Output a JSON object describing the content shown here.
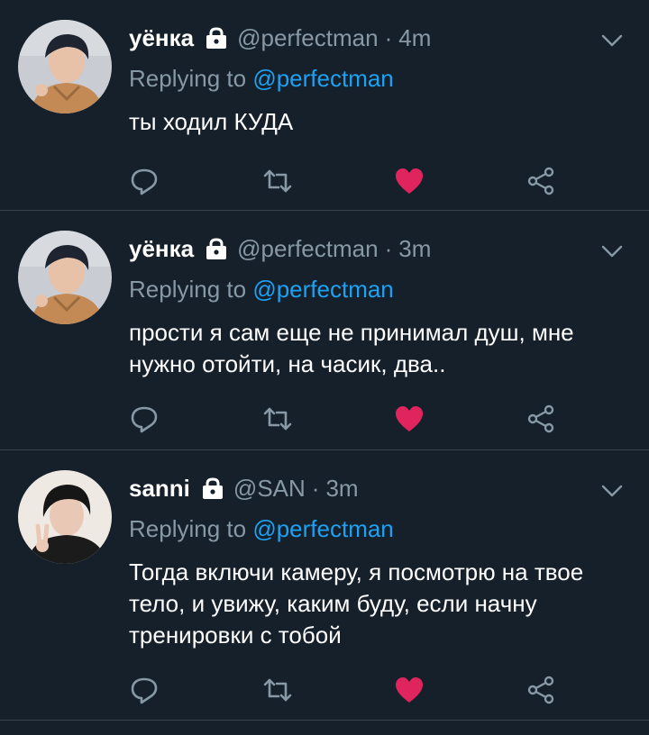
{
  "tweets": [
    {
      "name": "уёнка",
      "handle": "@perfectman",
      "separator": "·",
      "time": "4m",
      "replying_prefix": "Replying to ",
      "replying_to": "@perfectman",
      "text": "ты ходил КУДА",
      "liked": true,
      "avatar_colors": {
        "bg": "#c9ccd2",
        "hair": "#1e2430",
        "skin": "#e7c2a8",
        "shirt": "#c48a55"
      }
    },
    {
      "name": "уёнка",
      "handle": "@perfectman",
      "separator": "·",
      "time": "3m",
      "replying_prefix": "Replying to ",
      "replying_to": "@perfectman",
      "text": "прости я сам еще не принимал душ, мне нужно отойти, на часик, два..",
      "liked": true,
      "avatar_colors": {
        "bg": "#c9ccd2",
        "hair": "#1e2430",
        "skin": "#e7c2a8",
        "shirt": "#c48a55"
      }
    },
    {
      "name": "sanni",
      "handle": "@SAN",
      "separator": "·",
      "time": "3m",
      "replying_prefix": "Replying to ",
      "replying_to": "@perfectman",
      "text": "Тогда включи камеру, я посмотрю на твое тело, и увижу, каким буду, если начну тренировки с тобой",
      "liked": true,
      "avatar_colors": {
        "bg": "#efe9e3",
        "hair": "#161616",
        "skin": "#e9c9b5",
        "shirt": "#1b1b1b"
      }
    }
  ],
  "colors": {
    "background": "#15202b",
    "secondary_text": "#8899a6",
    "link": "#1da1f2",
    "like": "#e0245e",
    "divider": "#38444d"
  },
  "icons": {
    "lock": "lock-icon",
    "chevron": "chevron-down-icon",
    "reply": "reply-icon",
    "retweet": "retweet-icon",
    "like": "heart-icon",
    "share": "share-icon"
  }
}
